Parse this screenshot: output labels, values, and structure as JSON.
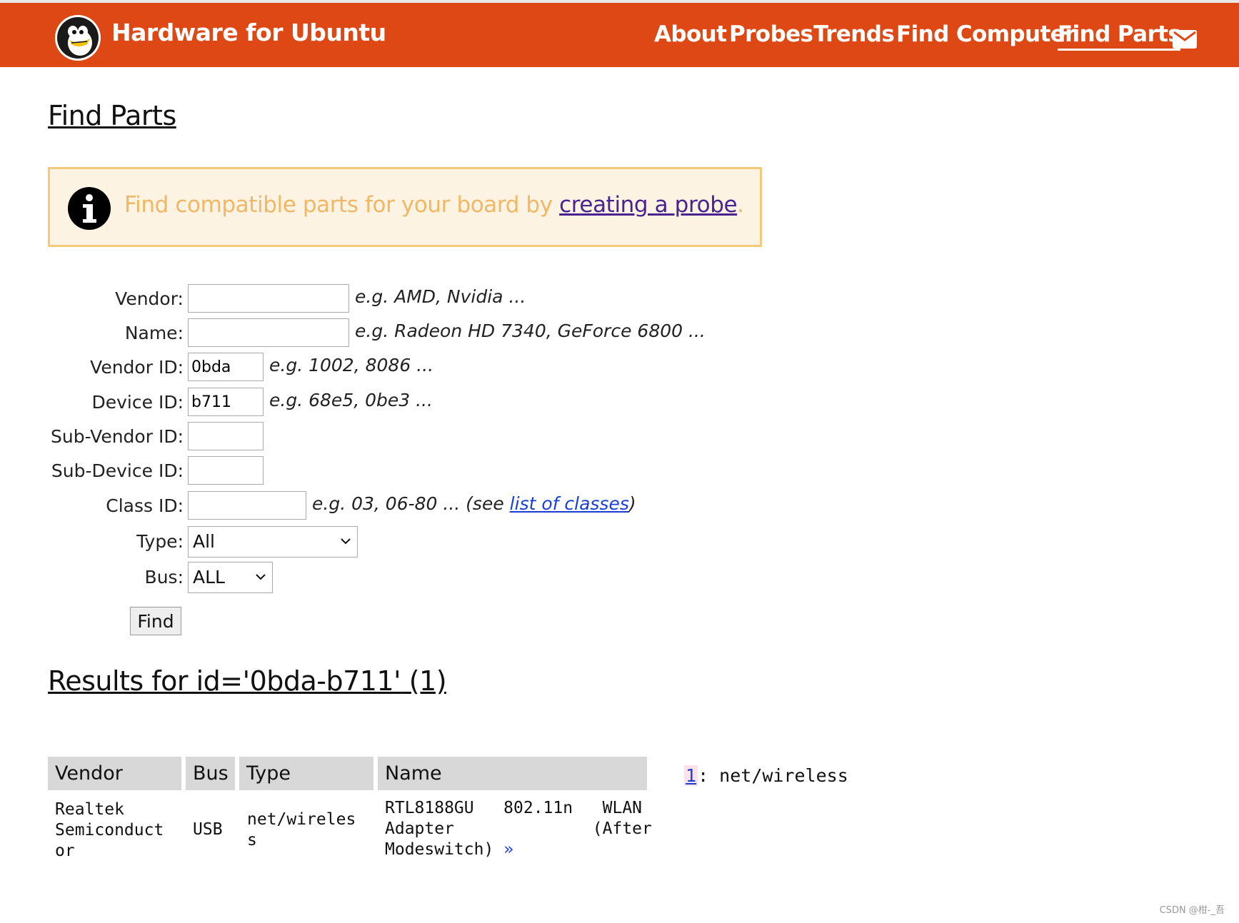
{
  "header": {
    "site_title": "Hardware for Ubuntu",
    "nav": [
      {
        "label": "About"
      },
      {
        "label": "Probes"
      },
      {
        "label": "Trends"
      },
      {
        "label": "Find Computer"
      },
      {
        "label": "Find Parts",
        "active": true
      }
    ],
    "mail_icon": "envelope-icon",
    "logo_icon": "penguin-logo"
  },
  "page_title": "Find Parts",
  "notice": {
    "icon": "info-icon",
    "text_before": "Find compatible parts for your board by ",
    "link_text": "creating a probe",
    "text_after": "."
  },
  "form": {
    "vendor": {
      "label": "Vendor:",
      "value": "",
      "hint": "e.g. AMD, Nvidia ..."
    },
    "name": {
      "label": "Name:",
      "value": "",
      "hint": "e.g. Radeon HD 7340, GeForce 6800 ..."
    },
    "vendor_id": {
      "label": "Vendor ID:",
      "value": "0bda",
      "hint": "e.g. 1002, 8086 ..."
    },
    "device_id": {
      "label": "Device ID:",
      "value": "b711",
      "hint": "e.g. 68e5, 0be3 ..."
    },
    "sub_vendor_id": {
      "label": "Sub-Vendor ID:",
      "value": ""
    },
    "sub_device_id": {
      "label": "Sub-Device ID:",
      "value": ""
    },
    "class_id": {
      "label": "Class ID:",
      "value": "",
      "hint_before": "e.g. 03, 06-80 ... (see ",
      "hint_link": "list of classes",
      "hint_after": ")"
    },
    "type": {
      "label": "Type:",
      "selected": "All"
    },
    "bus": {
      "label": "Bus:",
      "selected": "ALL"
    },
    "find_label": "Find"
  },
  "results": {
    "title_text": "Results for id='0bda-b711'",
    "count_text": " (1)",
    "columns": [
      "Vendor",
      "Bus",
      "Type",
      "Name"
    ],
    "rows": [
      {
        "vendor": "Realtek\nSemiconduct\nor",
        "bus": "USB",
        "type": "net/wireles\ns",
        "name": "RTL8188GU   802.11n   WLAN\nAdapter              (After\nModeswitch)",
        "more": "»"
      }
    ],
    "class_ref_num": "1",
    "class_ref_text": ":  net/wireless"
  },
  "watermark": "CSDN @柑-_吾"
}
